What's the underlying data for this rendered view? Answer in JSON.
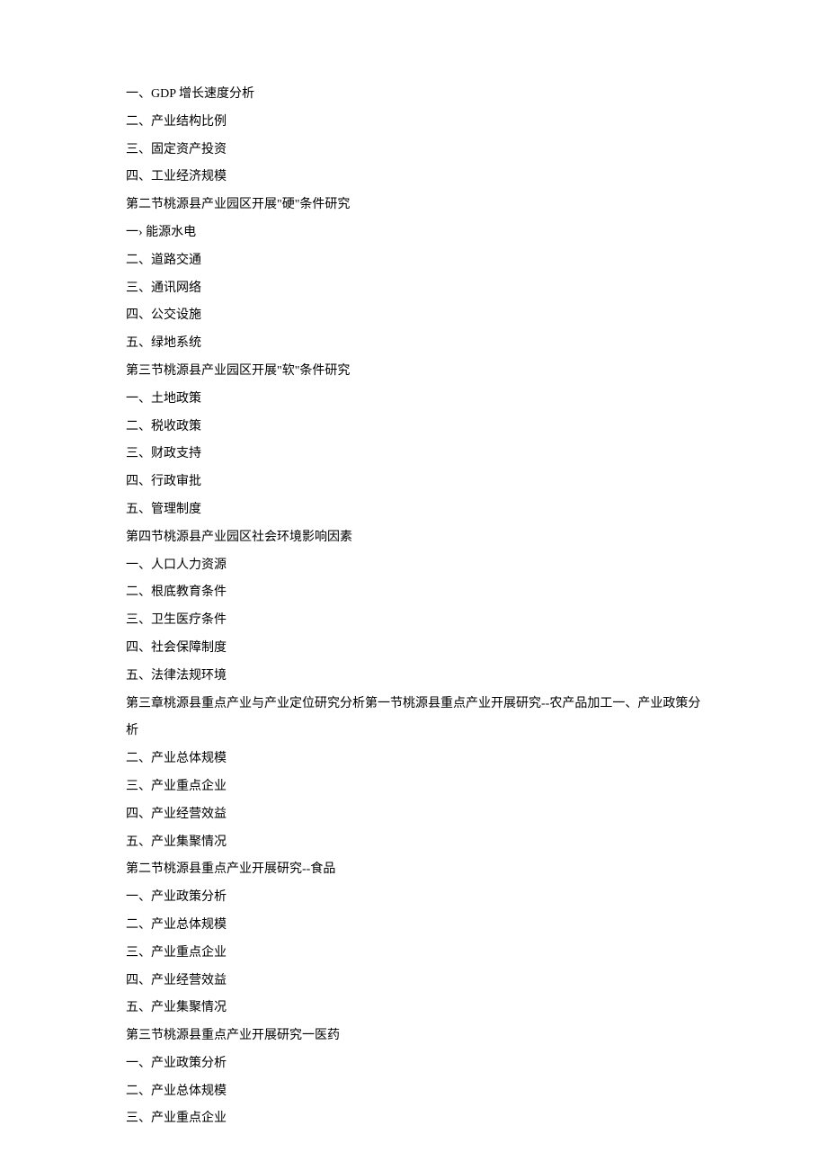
{
  "lines": [
    "一、GDP 增长速度分析",
    "二、产业结构比例",
    "三、固定资产投资",
    "四、工业经济规模",
    "第二节桃源县产业园区开展\"硬\"条件研究",
    "一› 能源水电",
    "二、道路交通",
    "三、通讯网络",
    "四、公交设施",
    "五、绿地系统",
    "第三节桃源县产业园区开展\"软\"条件研究",
    "一、土地政策",
    "二、税收政策",
    "三、财政支持",
    "四、行政审批",
    "五、管理制度",
    "第四节桃源县产业园区社会环境影响因素",
    "一、人口人力资源",
    "二、根底教育条件",
    "三、卫生医疗条件",
    "四、社会保障制度",
    "五、法律法规环境",
    "第三章桃源县重点产业与产业定位研究分析第一节桃源县重点产业开展研究--农产品加工一、产业政策分析",
    "二、产业总体规模",
    "三、产业重点企业",
    "四、产业经营效益",
    "五、产业集聚情况",
    "第二节桃源县重点产业开展研究--食品",
    "一、产业政策分析",
    "二、产业总体规模",
    "三、产业重点企业",
    "四、产业经营效益",
    "五、产业集聚情况",
    "第三节桃源县重点产业开展研究一医药",
    "一、产业政策分析",
    "二、产业总体规模",
    "三、产业重点企业"
  ]
}
